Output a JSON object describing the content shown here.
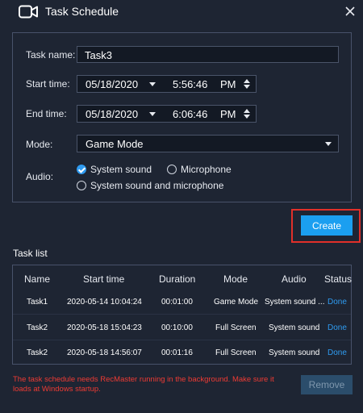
{
  "window": {
    "title": "Task Schedule"
  },
  "form": {
    "task_name_label": "Task name:",
    "task_name_value": "Task3",
    "start_time_label": "Start time:",
    "start_date": "05/18/2020",
    "start_time": "5:56:46",
    "start_ampm": "PM",
    "end_time_label": "End time:",
    "end_date": "05/18/2020",
    "end_time": "6:06:46",
    "end_ampm": "PM",
    "mode_label": "Mode:",
    "mode_value": "Game Mode",
    "audio_label": "Audio:",
    "audio_options": [
      {
        "label": "System sound",
        "checked": true
      },
      {
        "label": "Microphone",
        "checked": false
      },
      {
        "label": "System sound and microphone",
        "checked": false
      }
    ]
  },
  "create_button_label": "Create",
  "task_list": {
    "title": "Task list",
    "columns": [
      "Name",
      "Start time",
      "Duration",
      "Mode",
      "Audio",
      "Status"
    ],
    "rows": [
      {
        "name": "Task1",
        "start": "2020-05-14 10:04:24",
        "duration": "00:01:00",
        "mode": "Game Mode",
        "audio": "System sound ...",
        "status": "Done"
      },
      {
        "name": "Task2",
        "start": "2020-05-18 15:04:23",
        "duration": "00:10:00",
        "mode": "Full Screen",
        "audio": "System sound",
        "status": "Done"
      },
      {
        "name": "Task2",
        "start": "2020-05-18 14:56:07",
        "duration": "00:01:16",
        "mode": "Full Screen",
        "audio": "System sound",
        "status": "Done"
      }
    ]
  },
  "notice": "The task schedule needs RecMaster running in the background. Make sure it loads at Windows startup.",
  "remove_button_label": "Remove",
  "colors": {
    "background": "#1e2533",
    "accent": "#1b9ff0",
    "highlight": "#e1302a",
    "warning_text": "#ee3b34"
  },
  "icons": {
    "app": "video-camera-icon",
    "close": "close-icon"
  }
}
